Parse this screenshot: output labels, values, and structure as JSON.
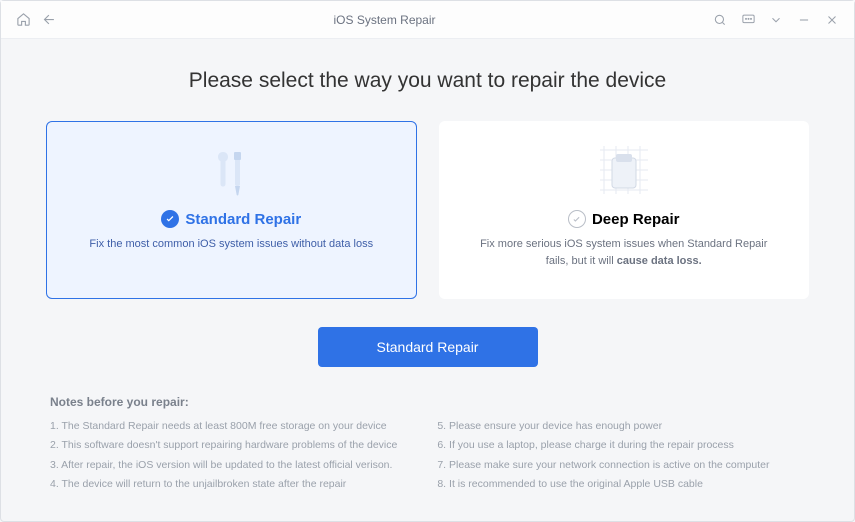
{
  "titlebar": {
    "title": "iOS System Repair"
  },
  "page": {
    "heading": "Please select the way you want to repair the device"
  },
  "cards": {
    "standard": {
      "title": "Standard Repair",
      "desc": "Fix the most common iOS system issues without data loss"
    },
    "deep": {
      "title": "Deep Repair",
      "desc_prefix": "Fix more serious iOS system issues when Standard Repair fails, but it will ",
      "desc_bold": "cause data loss."
    }
  },
  "action": {
    "primary": "Standard Repair"
  },
  "notes": {
    "heading": "Notes before you repair:",
    "left": [
      "The Standard Repair needs at least 800M free storage on your device",
      "This software doesn't support repairing hardware problems of the device",
      "After repair, the iOS version will be updated to the latest official verison.",
      "The device will return to the unjailbroken state after the repair"
    ],
    "right": [
      "Please ensure your device has enough power",
      "If you use a laptop, please charge it during the repair process",
      "Please make sure your network connection is active on the computer",
      "It is recommended to use the original Apple USB cable"
    ]
  }
}
